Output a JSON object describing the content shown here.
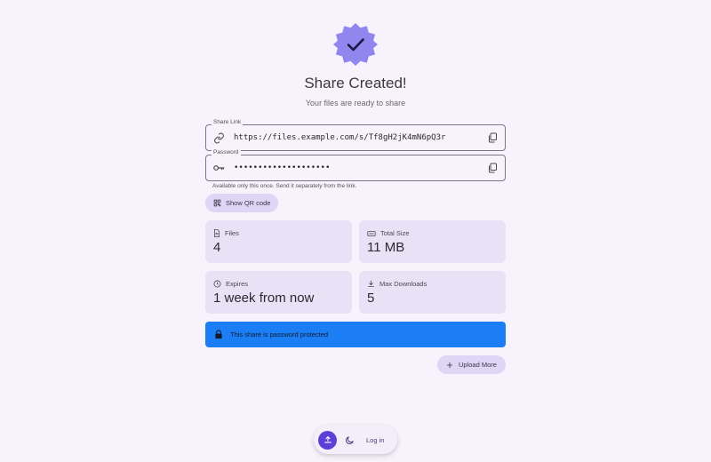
{
  "header": {
    "badge_icon": "verified-badge-icon",
    "title": "Share Created!",
    "subtitle": "Your files are ready to share"
  },
  "share_link": {
    "label": "Share Link",
    "value": "https://files.example.com/s/Tf8gH2jK4mN6pQ3r",
    "icon": "link-icon",
    "copy_icon": "copy-icon"
  },
  "password": {
    "label": "Password",
    "value": "••••••••••••••••••••",
    "icon": "key-icon",
    "copy_icon": "copy-icon"
  },
  "hint": "Available only this once. Send it separately from the link.",
  "qr_button": {
    "label": "Show QR code",
    "icon": "qr-code-icon"
  },
  "stats": {
    "files": {
      "label": "Files",
      "value": "4",
      "icon": "file-icon"
    },
    "total_size": {
      "label": "Total Size",
      "value": "11 MB",
      "icon": "storage-icon"
    },
    "expires": {
      "label": "Expires",
      "value": "1 week from now",
      "icon": "clock-icon"
    },
    "max_downloads": {
      "label": "Max Downloads",
      "value": "5",
      "icon": "download-icon"
    }
  },
  "banner": {
    "text": "This share is password protected",
    "icon": "lock-icon"
  },
  "upload_more": {
    "label": "Upload More",
    "icon": "plus-icon"
  },
  "bottom_bar": {
    "upload_icon": "upload-icon",
    "theme_icon": "moon-icon",
    "login_label": "Log in"
  },
  "colors": {
    "background": "#f7f2fb",
    "accent": "#5b3fd6",
    "badge": "#8f86ee",
    "card": "#e9e2f7",
    "tonal_button": "#ddd6f5",
    "banner": "#1c7ef5"
  }
}
